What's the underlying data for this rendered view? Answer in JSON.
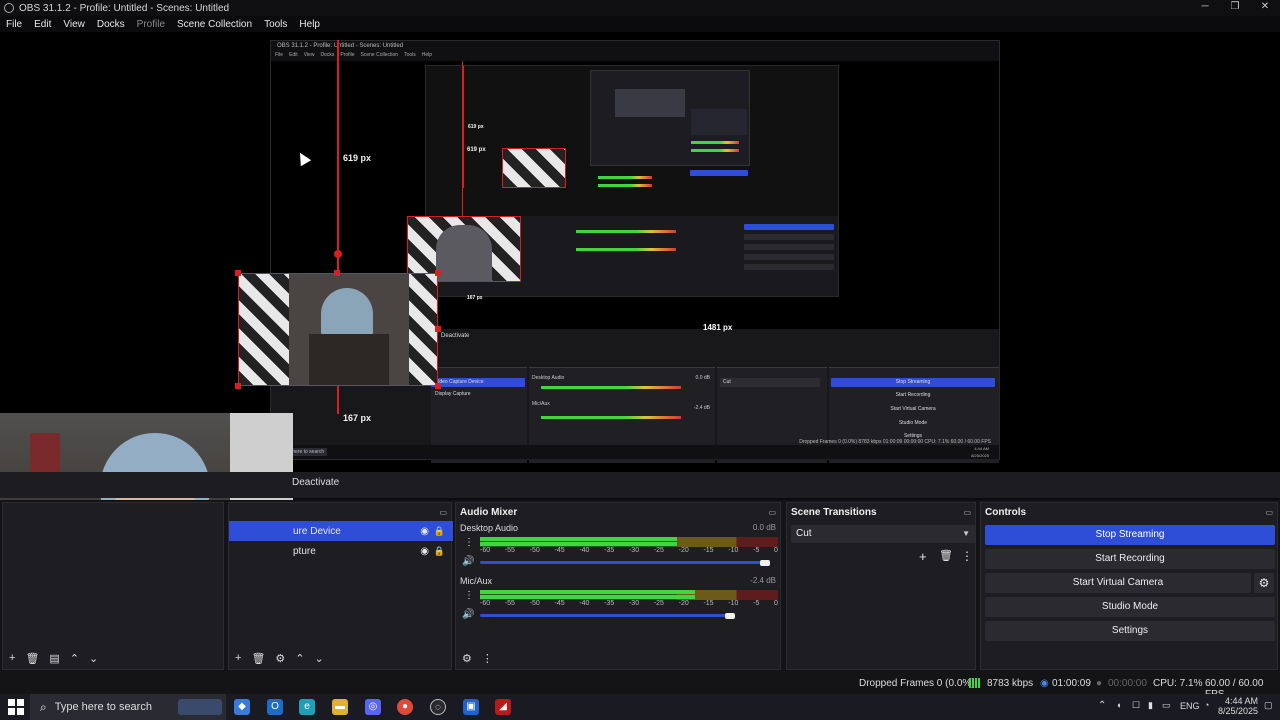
{
  "window": {
    "title": "OBS 31.1.2 - Profile: Untitled - Scenes: Untitled",
    "controls": [
      "─",
      "❐",
      "✕"
    ]
  },
  "menu": [
    "File",
    "Edit",
    "View",
    "Docks",
    "Profile",
    "Scene Collection",
    "Tools",
    "Help"
  ],
  "preview": {
    "measure_vertical": "619 px",
    "measure_bottom": "167 px",
    "measure_horizontal": "1481 px",
    "nested_title": "OBS 31.1.2 - Profile: Untitled - Scenes: Untitled",
    "nested_menu": [
      "File",
      "Edit",
      "View",
      "Docks",
      "Profile",
      "Scene Collection",
      "Tools",
      "Help"
    ],
    "nested_measure_vertical": "619 px",
    "nested_measure_bottom": "167 px",
    "nested_deactivate": "Deactivate",
    "nested_sources": [
      "Video Capture Device",
      "Display Capture"
    ],
    "nested_tracks": [
      "Desktop Audio",
      "Mic/Aux"
    ],
    "nested_dbs": [
      "0.0 dB",
      "-2.4 dB"
    ],
    "nested_transition": "Cut",
    "nested_controls": [
      "Stop Streaming",
      "Start Recording",
      "Start Virtual Camera",
      "Studio Mode",
      "Settings"
    ],
    "nested_status": "Dropped Frames 0 (0.0%)   8783 kbps   01:00:09   00:00:00   CPU: 7.1%   60.00 / 60.00 FPS",
    "nested_search": "Type here to search",
    "nested_time": "4:44 AM",
    "nested_date": "8/25/2025"
  },
  "source_toolbar": {
    "deactivate_label": "Deactivate"
  },
  "scenes_footer": [
    "+",
    "🗑",
    "▤",
    "⌃",
    "⌄"
  ],
  "sources": {
    "items": [
      {
        "label": "ure Device",
        "selected": true
      },
      {
        "label": "pture",
        "selected": false
      }
    ],
    "footer": [
      "+",
      "🗑",
      "⚙",
      "⌃",
      "⌄"
    ]
  },
  "audio_mixer": {
    "title": "Audio Mixer",
    "tracks": [
      {
        "name": "Desktop Audio",
        "db": "0.0 dB",
        "level": 0.66,
        "volume": 1.0
      },
      {
        "name": "Mic/Aux",
        "db": "-2.4 dB",
        "level": 0.72,
        "volume": 0.88
      }
    ],
    "scale": [
      "-60",
      "-55",
      "-50",
      "-45",
      "-40",
      "-35",
      "-30",
      "-25",
      "-20",
      "-15",
      "-10",
      "-5",
      "0"
    ],
    "footer": [
      "⚙",
      "⋮"
    ]
  },
  "scene_transitions": {
    "title": "Scene Transitions",
    "selected": "Cut",
    "buttons": [
      "+",
      "🗑",
      "⋮"
    ]
  },
  "controls": {
    "title": "Controls",
    "buttons": [
      "Stop Streaming",
      "Start Recording",
      "Start Virtual Camera",
      "Studio Mode",
      "Settings"
    ],
    "accent": "#2f4ed8"
  },
  "status": {
    "dropped_frames": "Dropped Frames 0 (0.0%)",
    "bitrate": "8783 kbps",
    "stream_time": "01:00:09",
    "record_time": "00:00:00",
    "cpu": "CPU: 7.1%",
    "fps": "60.00 / 60.00 FPS"
  },
  "taskbar": {
    "search_placeholder": "Type here to search",
    "language": "ENG",
    "time": "4:44 AM",
    "date": "8/25/2025"
  }
}
